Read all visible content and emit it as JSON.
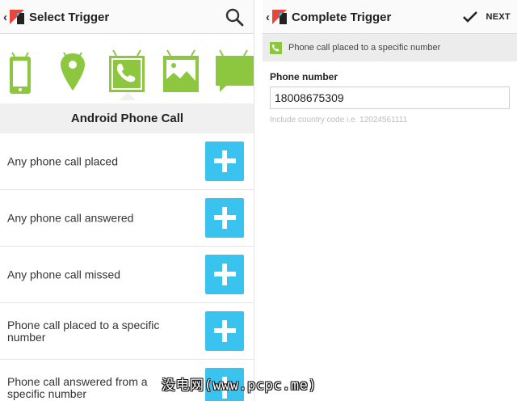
{
  "left_panel": {
    "title": "Select Trigger",
    "back_glyph": "‹",
    "channels": [
      {
        "name": "phone-device-icon",
        "selected": false
      },
      {
        "name": "location-pin-icon",
        "selected": false
      },
      {
        "name": "phone-call-icon",
        "selected": true
      },
      {
        "name": "photo-icon",
        "selected": false
      },
      {
        "name": "sms-icon",
        "selected": false
      }
    ],
    "section_title": "Android Phone Call",
    "triggers": [
      {
        "label": "Any phone call placed"
      },
      {
        "label": "Any phone call answered"
      },
      {
        "label": "Any phone call missed"
      },
      {
        "label": "Phone call placed to a specific number"
      },
      {
        "label": "Phone call answered from a specific number"
      }
    ]
  },
  "right_panel": {
    "title": "Complete Trigger",
    "back_glyph": "‹",
    "next_label": "NEXT",
    "selected_trigger": "Phone call placed to a specific number",
    "field_label": "Phone number",
    "phone_value": "18008675309",
    "help_text": "Include country code i.e. 12024561111"
  },
  "watermark": "没电网(www.pcpc.me)",
  "colors": {
    "accent_blue": "#3ac3ef",
    "android_green": "#8dc63f",
    "logo_red": "#e8473c"
  }
}
